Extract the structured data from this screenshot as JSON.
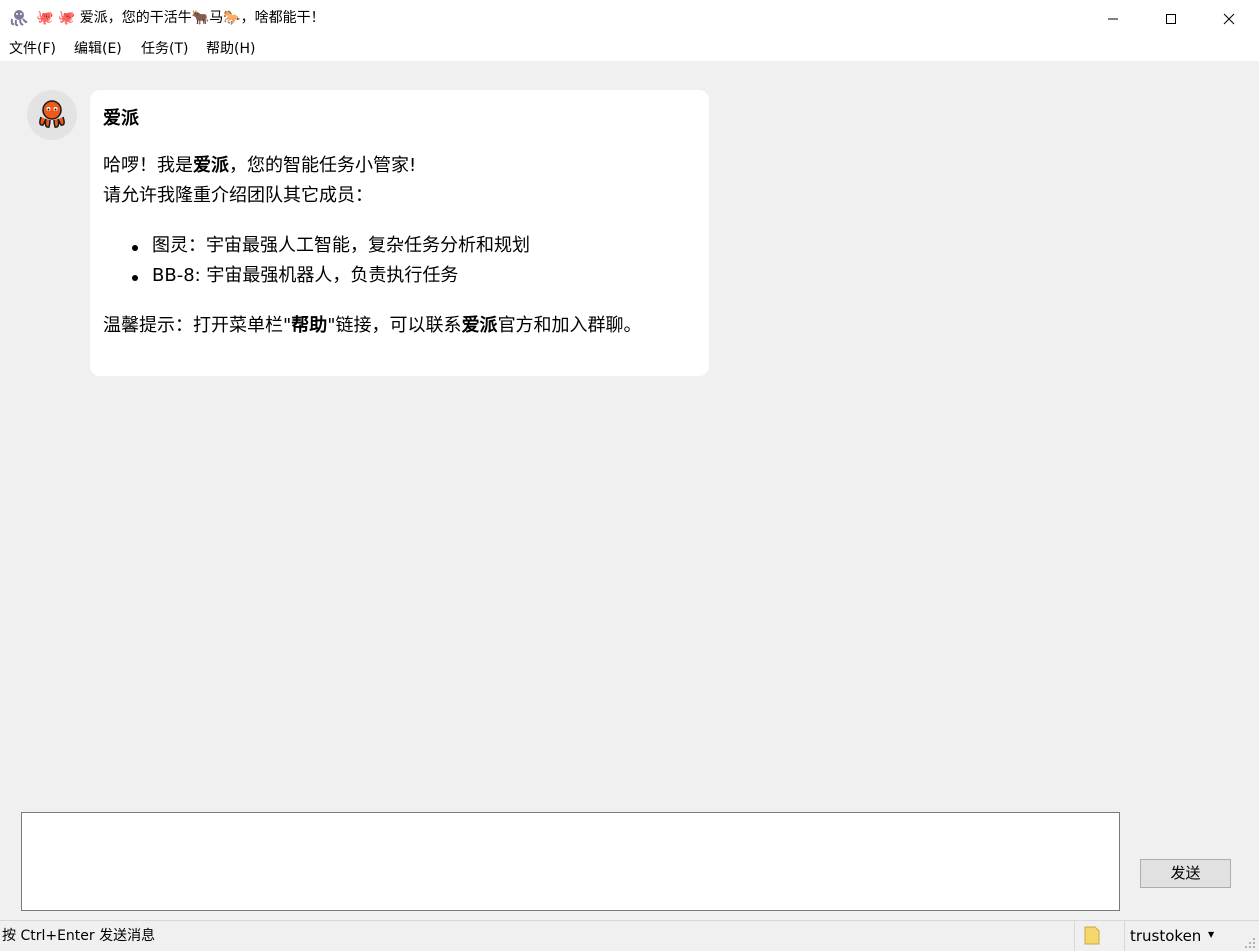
{
  "window": {
    "title": "🐙 🐙 爱派，您的干活牛🐂马🐎，啥都能干！"
  },
  "menu": {
    "items": [
      {
        "label": "文件(F)"
      },
      {
        "label": "编辑(E)"
      },
      {
        "label": "任务(T)"
      },
      {
        "label": "帮助(H)"
      }
    ]
  },
  "chat": {
    "messages": [
      {
        "sender": "爱派",
        "avatar_icon": "octopus-icon",
        "line1_a": "哈啰！我是",
        "line1_b": "爱派",
        "line1_c": "，您的智能任务小管家!",
        "line2": "请允许我隆重介绍团队其它成员：",
        "bullets": [
          "图灵：宇宙最强人工智能，复杂任务分析和规划",
          "BB-8: 宇宙最强机器人，负责执行任务"
        ],
        "tip_a": "温馨提示：打开菜单栏\"",
        "tip_b": "帮助",
        "tip_c": "\"链接，可以联系",
        "tip_d": "爱派",
        "tip_e": "官方和加入群聊。"
      }
    ]
  },
  "input": {
    "value": "",
    "send_label": "发送"
  },
  "status": {
    "hint": "按 Ctrl+Enter 发送消息",
    "folder_icon": "folder-icon",
    "token_selected": "trustoken"
  },
  "colors": {
    "octopus": "#f05a18",
    "folder": "#f5d76e",
    "background": "#f0f0f0"
  }
}
